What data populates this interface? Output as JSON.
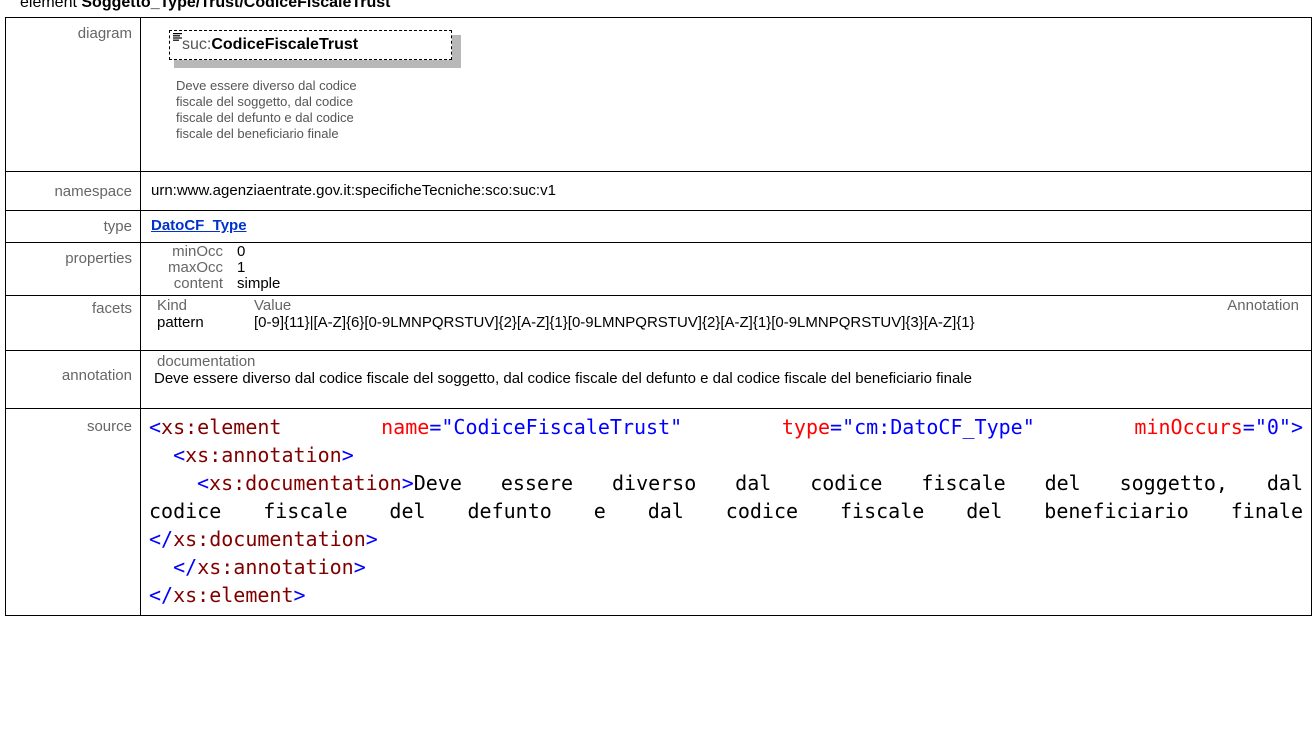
{
  "heading": {
    "prefix": "element ",
    "path": "Soggetto_Type/Trust/CodiceFiscaleTrust"
  },
  "rows": {
    "diagram": {
      "label": "diagram",
      "node_ns": "suc:",
      "node_name": "CodiceFiscaleTrust",
      "doc_lines": [
        "Deve essere diverso dal codice",
        "fiscale del soggetto, dal codice",
        "fiscale del defunto e dal codice",
        "fiscale del beneficiario finale"
      ]
    },
    "namespace": {
      "label": "namespace",
      "value": "urn:www.agenziaentrate.gov.it:specificheTecniche:sco:suc:v1"
    },
    "type": {
      "label": "type",
      "value": "DatoCF_Type"
    },
    "properties": {
      "label": "properties",
      "items": [
        {
          "key": "minOcc",
          "value": "0"
        },
        {
          "key": "maxOcc",
          "value": "1"
        },
        {
          "key": "content",
          "value": "simple"
        }
      ]
    },
    "facets": {
      "label": "facets",
      "headers": {
        "kind": "Kind",
        "value": "Value",
        "annotation": "Annotation"
      },
      "kind": "pattern",
      "value": "[0-9]{11}|[A-Z]{6}[0-9LMNPQRSTUV]{2}[A-Z]{1}[0-9LMNPQRSTUV]{2}[A-Z]{1}[0-9LMNPQRSTUV]{3}[A-Z]{1}"
    },
    "annotation": {
      "label": "annotation",
      "header": "documentation",
      "text": "Deve essere diverso dal codice fiscale del soggetto, dal codice fiscale del defunto e dal codice fiscale del beneficiario finale"
    },
    "source": {
      "label": "source",
      "el_open": "xs:element",
      "attr1_name": "name",
      "attr1_value": "\"CodiceFiscaleTrust\"",
      "attr2_name": "type",
      "attr2_value": "\"cm:DatoCF_Type\"",
      "attr3_name": "minOccurs",
      "attr3_value": "\"0\"",
      "ann_tag": "xs:annotation",
      "doc_tag": "xs:documentation",
      "doc_text_1": "Deve essere diverso dal codice fiscale del soggetto, dal",
      "doc_text_2": "codice fiscale del defunto e dal codice fiscale del beneficiario finale"
    }
  }
}
